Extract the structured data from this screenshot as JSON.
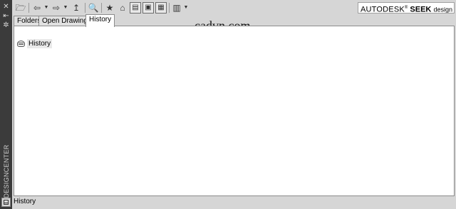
{
  "sidebar": {
    "title": "DESIGNCENTER",
    "icons": [
      "close-icon",
      "autohide-icon",
      "properties-icon",
      "dc-window-icon"
    ]
  },
  "toolbar": {
    "icons": [
      "load-icon",
      "back-icon",
      "forward-icon",
      "up-icon",
      "search-icon",
      "favorites-icon",
      "home-icon",
      "tree-view-toggle-icon",
      "preview-icon",
      "description-icon",
      "views-icon"
    ]
  },
  "brand": {
    "autodesk": "AUTODESK",
    "registered": "®",
    "seek": "SEEK",
    "design_content": "design content"
  },
  "watermark": "cadvn.com",
  "tabs": [
    {
      "label": "Folders"
    },
    {
      "label": "Open Drawings"
    },
    {
      "label": "History",
      "active": true
    }
  ],
  "tree": {
    "items": [
      {
        "label": "History"
      }
    ]
  },
  "status": {
    "text": "History"
  },
  "colors": {
    "panel_bg": "#d6d6d6",
    "side_strip": "#3b3b3b",
    "content_bg": "#ffffff"
  }
}
